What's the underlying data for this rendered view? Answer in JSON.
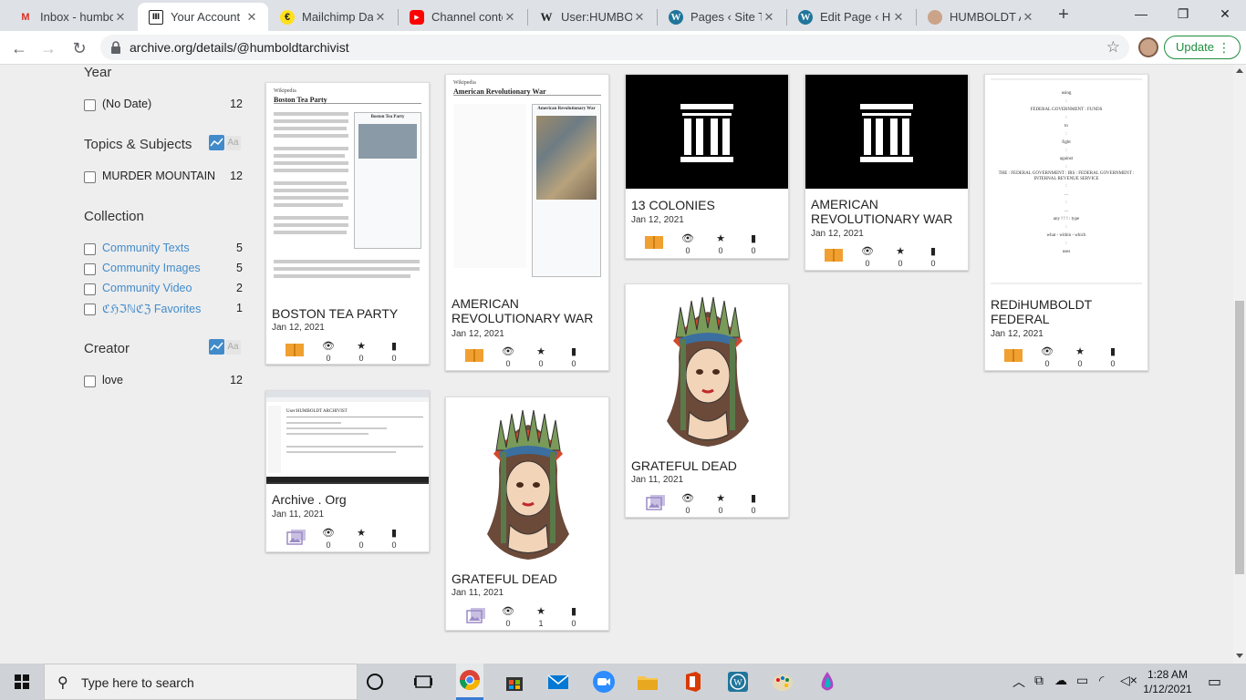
{
  "tabs": [
    {
      "title": "Inbox - humbo",
      "icon": "gmail-icon",
      "active": false
    },
    {
      "title": "Your Account",
      "icon": "archive-icon",
      "active": true
    },
    {
      "title": "Mailchimp Das",
      "icon": "mailchimp-icon",
      "active": false
    },
    {
      "title": "Channel conte",
      "icon": "youtube-icon",
      "active": false
    },
    {
      "title": "User:HUMBOL",
      "icon": "wikipedia-icon",
      "active": false
    },
    {
      "title": "Pages ‹ Site Tit",
      "icon": "wordpress-icon",
      "active": false
    },
    {
      "title": "Edit Page ‹ HU",
      "icon": "wordpress-icon",
      "active": false
    },
    {
      "title": "HUMBOLDT AI",
      "icon": "avatar-icon",
      "active": false
    }
  ],
  "window": {
    "minimize": "—",
    "maximize": "❐",
    "close": "✕"
  },
  "nav": {
    "url": "archive.org/details/@humboldtarchivist",
    "update_label": "Update"
  },
  "facets": {
    "year": {
      "title": "Year",
      "items": [
        {
          "label": "(No Date)",
          "count": "12"
        }
      ]
    },
    "topics": {
      "title": "Topics & Subjects",
      "items": [
        {
          "label": "MURDER MOUNTAIN",
          "count": "12"
        }
      ]
    },
    "collection": {
      "title": "Collection",
      "items": [
        {
          "label": "Community Texts",
          "count": "5"
        },
        {
          "label": "Community Images",
          "count": "5"
        },
        {
          "label": "Community Video",
          "count": "2"
        },
        {
          "label": "ℭℌℑℕℭℨ Favorites",
          "count": "1"
        }
      ]
    },
    "creator": {
      "title": "Creator",
      "items": [
        {
          "label": "love",
          "count": "12"
        }
      ]
    },
    "aa_label": "Aa"
  },
  "cards": [
    {
      "title": "BOSTON TEA PARTY",
      "date": "Jan 12, 2021",
      "mediatype": "texts",
      "views": "0",
      "favs": "0",
      "reviews": "0",
      "thumb": {
        "site": "Wikipedia",
        "heading": "Boston Tea Party",
        "infobox": "Boston Tea Party"
      }
    },
    {
      "title": "Archive . Org",
      "date": "Jan 11, 2021",
      "mediatype": "image",
      "views": "0",
      "favs": "0",
      "reviews": "0",
      "thumb": {
        "heading": "User:HUMBOLDT ARCHIVIST"
      }
    },
    {
      "title": "AMERICAN REVOLUTIONARY WAR",
      "date": "Jan 12, 2021",
      "mediatype": "texts",
      "views": "0",
      "favs": "0",
      "reviews": "0",
      "thumb": {
        "site": "Wikipedia",
        "heading": "American Revolutionary War",
        "infobox": "American Revolutionary War"
      }
    },
    {
      "title": "GRATEFUL DEAD",
      "date": "Jan 11, 2021",
      "mediatype": "image",
      "views": "0",
      "favs": "1",
      "reviews": "0"
    },
    {
      "title": "13 COLONIES",
      "date": "Jan 12, 2021",
      "mediatype": "texts",
      "views": "0",
      "favs": "0",
      "reviews": "0"
    },
    {
      "title": "GRATEFUL DEAD",
      "date": "Jan 11, 2021",
      "mediatype": "image",
      "views": "0",
      "favs": "0",
      "reviews": "0"
    },
    {
      "title": "AMERICAN REVOLUTIONARY WAR",
      "date": "Jan 12, 2021",
      "mediatype": "texts",
      "views": "0",
      "favs": "0",
      "reviews": "0"
    },
    {
      "title": "REDiHUMBOLDT FEDERAL",
      "date": "Jan 12, 2021",
      "mediatype": "texts",
      "views": "0",
      "favs": "0",
      "reviews": "0",
      "thumb": {
        "lines": [
          "using",
          ":",
          "FEDERAL GOVERNMENT : FUNDS",
          ":",
          "to",
          ":",
          "fight",
          ":",
          "against",
          ":",
          "THE : FEDERAL GOVERNMENT : IRS : FEDERAL GOVERNMENT : INTERNAL REVENUE SERVICE",
          ":",
          "...",
          ":",
          "...",
          "any ! ! ! : type",
          ":",
          "what - within - which",
          ":",
          "uses"
        ]
      }
    }
  ],
  "taskbar": {
    "search_placeholder": "Type here to search",
    "time": "1:28 AM",
    "date": "1/12/2021"
  },
  "colors": {
    "accent": "#428bca",
    "update_green": "#1e8e3e",
    "texts_icon": "#f0a030",
    "image_icon": "#9b8bc4"
  }
}
